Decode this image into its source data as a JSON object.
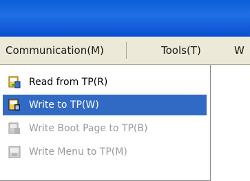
{
  "menubar": {
    "items": [
      {
        "label": "Communication(M)"
      },
      {
        "label": "Tools(T)"
      },
      {
        "label": "W"
      }
    ]
  },
  "dropdown": {
    "items": [
      {
        "label": "Read from TP(R)",
        "icon": "read-from-tp-icon",
        "state": "normal"
      },
      {
        "label": "Write to TP(W)",
        "icon": "write-to-tp-icon",
        "state": "selected"
      },
      {
        "label": "Write Boot Page to TP(B)",
        "icon": "write-boot-page-icon",
        "state": "disabled"
      },
      {
        "label": "Write Menu to TP(M)",
        "icon": "write-menu-icon",
        "state": "disabled"
      }
    ]
  },
  "colors": {
    "titlebar": "#0a5fd8",
    "menubar_bg": "#ece9d8",
    "selection": "#316ac5",
    "disabled_text": "#9a9a9a"
  }
}
